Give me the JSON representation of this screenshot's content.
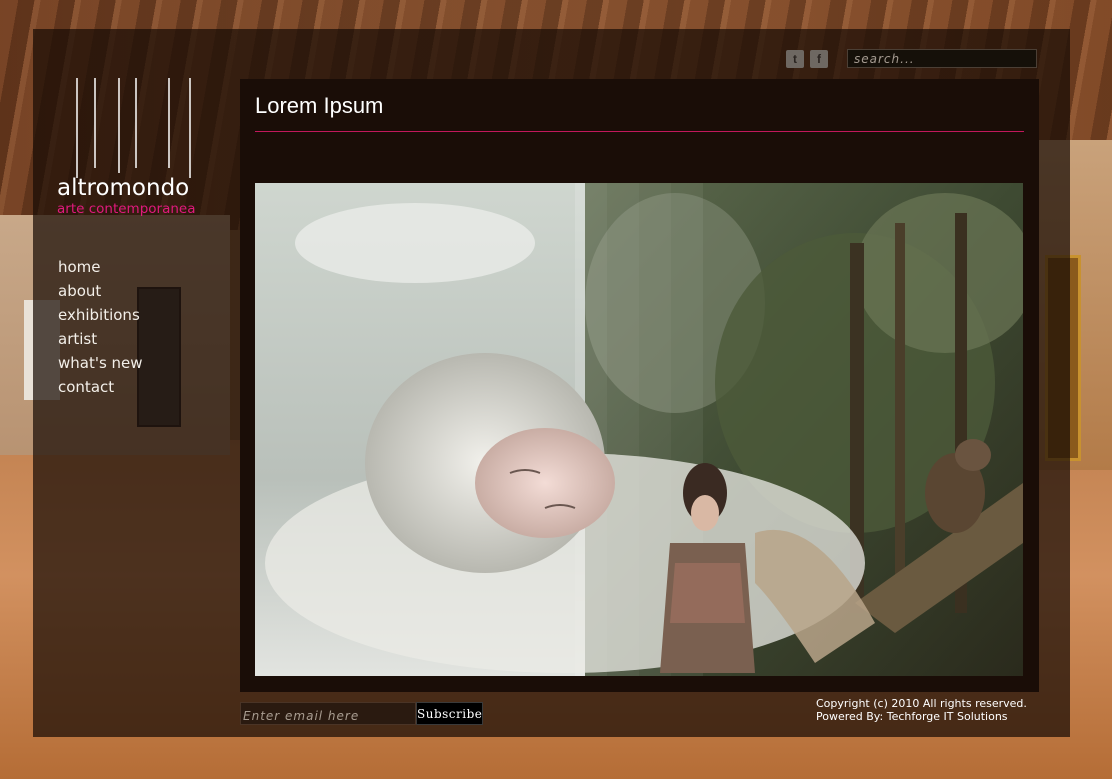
{
  "site": {
    "logo_text": "altromondo",
    "logo_tagline": "arte contemporanea"
  },
  "nav": {
    "items": [
      {
        "label": "home"
      },
      {
        "label": "about"
      },
      {
        "label": "exhibitions"
      },
      {
        "label": "artist"
      },
      {
        "label": "what's new"
      },
      {
        "label": "contact"
      }
    ]
  },
  "header": {
    "social": [
      {
        "icon": "twitter-icon",
        "glyph": "t"
      },
      {
        "icon": "facebook-icon",
        "glyph": "f"
      }
    ],
    "search": {
      "placeholder": "search..."
    }
  },
  "main": {
    "title": "Lorem Ipsum"
  },
  "footer": {
    "email_placeholder": "Enter email here",
    "subscribe_label": "Subscribe",
    "copyright": "Copyright (c) 2010 All rights reserved.",
    "powered_by": "Powered By: Techforge IT Solutions"
  },
  "colors": {
    "accent": "#e0197d",
    "panel": "#1a0d07",
    "rule": "#c2185b"
  }
}
